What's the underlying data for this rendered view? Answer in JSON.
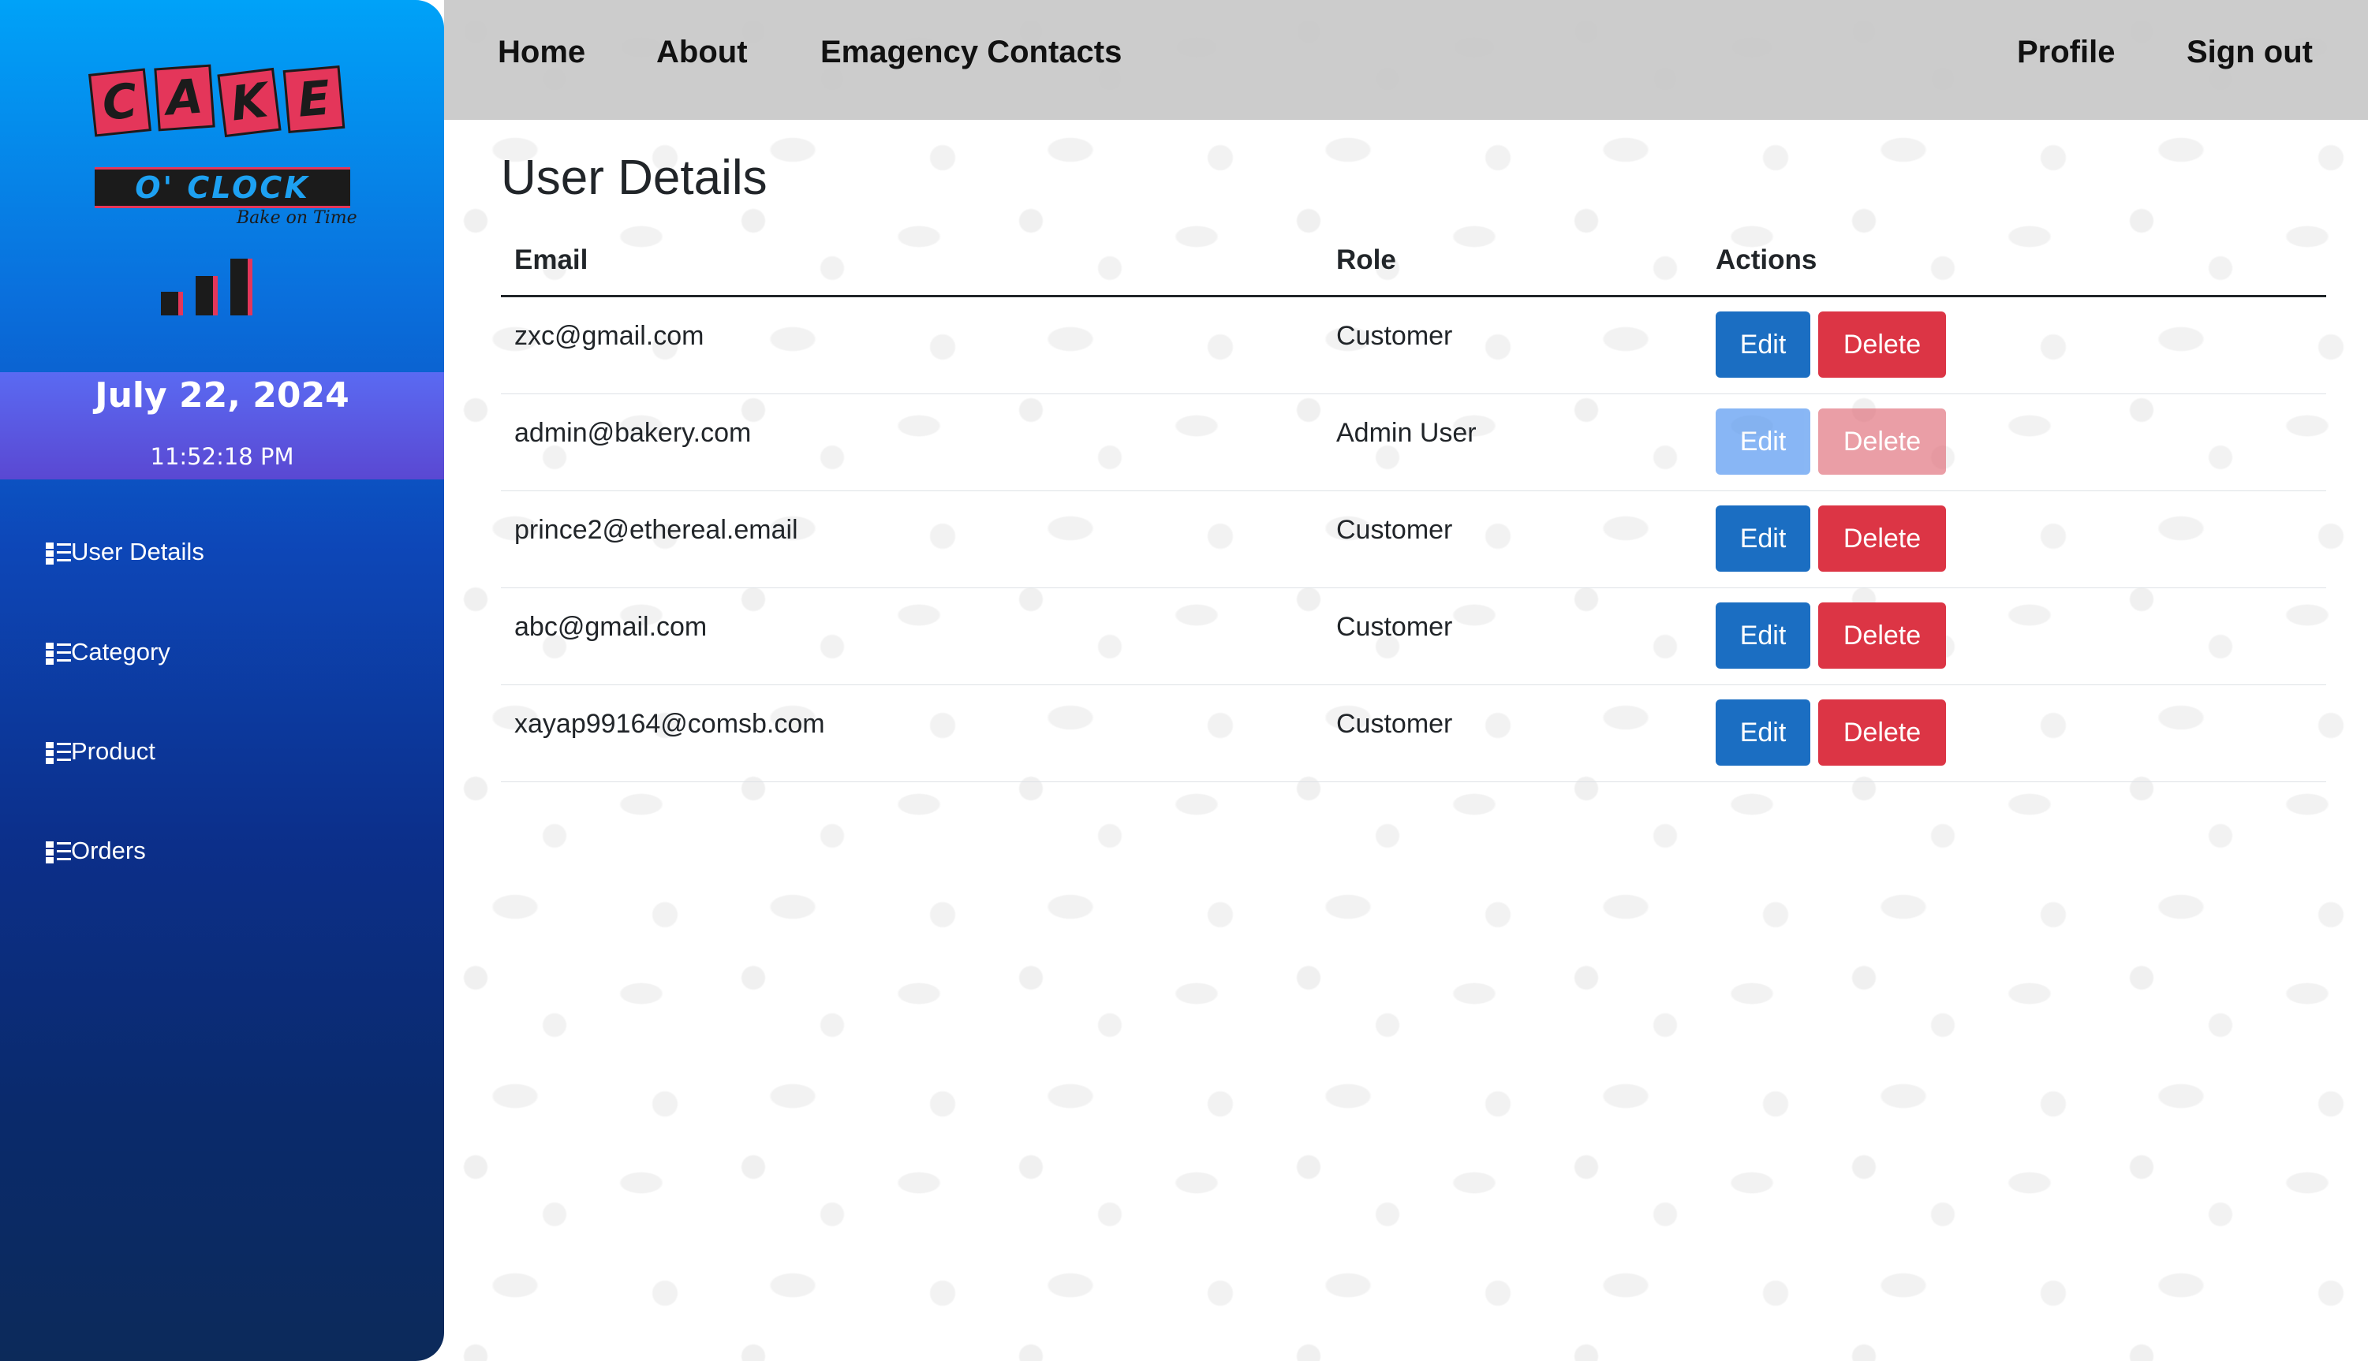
{
  "brand": {
    "logo_letters": [
      "C",
      "A",
      "K",
      "E"
    ],
    "logo_subtitle": "O' CLOCK",
    "logo_tagline": "Bake on Time"
  },
  "sidebar": {
    "date": "July 22, 2024",
    "time": "11:52:18 PM",
    "items": [
      {
        "label": "User Details",
        "icon": "list-icon"
      },
      {
        "label": "Category",
        "icon": "list-icon"
      },
      {
        "label": "Product",
        "icon": "list-icon"
      },
      {
        "label": "Orders",
        "icon": "list-icon"
      }
    ]
  },
  "topnav": {
    "left": [
      "Home",
      "About",
      "Emagency Contacts"
    ],
    "right": [
      "Profile",
      "Sign out"
    ]
  },
  "page": {
    "title": "User Details"
  },
  "table": {
    "headers": [
      "Email",
      "Role",
      "Actions"
    ],
    "rows": [
      {
        "email": "zxc@gmail.com",
        "role": "Customer",
        "disabled": false
      },
      {
        "email": "admin@bakery.com",
        "role": "Admin User",
        "disabled": true
      },
      {
        "email": "prince2@ethereal.email",
        "role": "Customer",
        "disabled": false
      },
      {
        "email": "abc@gmail.com",
        "role": "Customer",
        "disabled": false
      },
      {
        "email": "xayap99164@comsb.com",
        "role": "Customer",
        "disabled": false
      }
    ],
    "edit_label": "Edit",
    "delete_label": "Delete"
  },
  "colors": {
    "edit_button": "#1b6ec2",
    "delete_button": "#dc3545",
    "topbar": "#c8c8c8",
    "sidebar_top": "#00a2f8",
    "sidebar_bottom": "#0c2a5a",
    "date_band": "#5a5ae0"
  }
}
